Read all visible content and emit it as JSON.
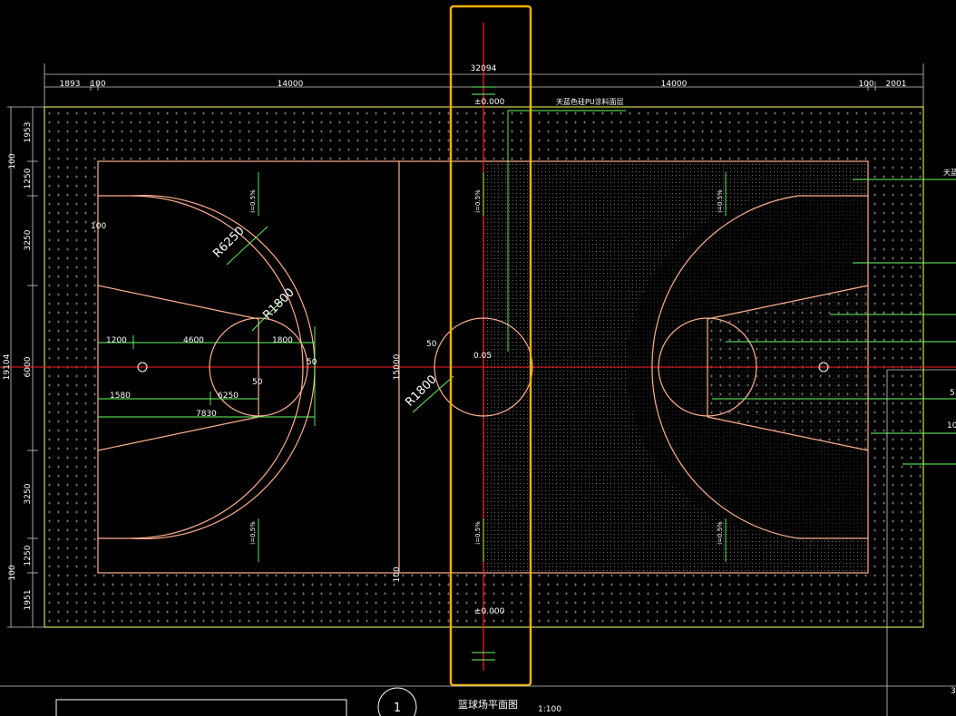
{
  "drawing": {
    "overall_width": "32094",
    "top_dims": [
      "1893",
      "100",
      "14000",
      "14000",
      "100",
      "2001"
    ],
    "left_total": "19104",
    "left_dims": [
      "1953",
      "100",
      "1250",
      "3250",
      "6000",
      "3250",
      "1250",
      "100",
      "1951"
    ],
    "left_label_100": "100",
    "court_width": "15000",
    "bottom_dim_100": "100",
    "elev_top": "±0.000",
    "elev_bottom": "±0.000",
    "center_note": "0.05",
    "center_50": "50",
    "material_note": "天蓝色硅PU涂料面层",
    "right_note": "天蓝",
    "slope": "i=0.5%",
    "radius_3pt": "R6250",
    "radius_ft": "R1800",
    "radius_center": "R1800",
    "dim_1200": "1200",
    "dim_4600": "4600",
    "dim_1800": "1800",
    "dim_1580": "1580",
    "dim_6250": "6250",
    "dim_7830": "7830",
    "dim_50_a": "50",
    "dim_50_b": "50",
    "dim_100_key": "100",
    "side_5": "5",
    "side_10": "10",
    "side_3": "3",
    "title_number": "1",
    "title": "篮球场平面图",
    "scale": "1:100"
  },
  "colors": {
    "background": "#000000",
    "border": "#ffff66",
    "court_line": "#ffb090",
    "axis": "#ff2020",
    "dimension": "#66ff66",
    "highlight": "#f0b000",
    "text": "#ffffff"
  }
}
